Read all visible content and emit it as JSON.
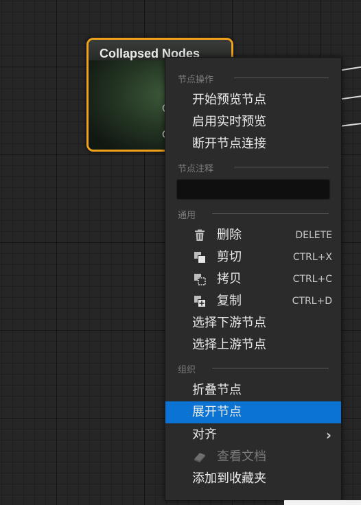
{
  "node": {
    "title": "Collapsed Nodes",
    "pin_1": "O",
    "pin_2": "O"
  },
  "menu": {
    "section_node_actions": "节点操作",
    "start_preview": "开始预览节点",
    "enable_live_preview": "启用实时预览",
    "break_links": "断开节点连接",
    "section_node_comment": "节点注释",
    "comment_value": "",
    "section_general": "通用",
    "delete": {
      "label": "删除",
      "icon": "trash-icon",
      "shortcut": "DELETE"
    },
    "cut": {
      "label": "剪切",
      "icon": "cut-icon",
      "shortcut": "CTRL+X"
    },
    "copy": {
      "label": "拷贝",
      "icon": "copy-icon",
      "shortcut": "CTRL+C"
    },
    "duplicate": {
      "label": "复制",
      "icon": "duplicate-icon",
      "shortcut": "CTRL+D"
    },
    "select_downstream": "选择下游节点",
    "select_upstream": "选择上游节点",
    "section_organize": "组织",
    "collapse_nodes": "折叠节点",
    "expand_nodes": "展开节点",
    "align": "对齐",
    "view_docs": {
      "label": "查看文档",
      "icon": "documentation-icon"
    },
    "add_to_favorites": "添加到收藏夹"
  },
  "colors": {
    "node_border": "#f0a21c",
    "selection": "#0a73d4",
    "menu_bg": "#2b2b2b"
  }
}
